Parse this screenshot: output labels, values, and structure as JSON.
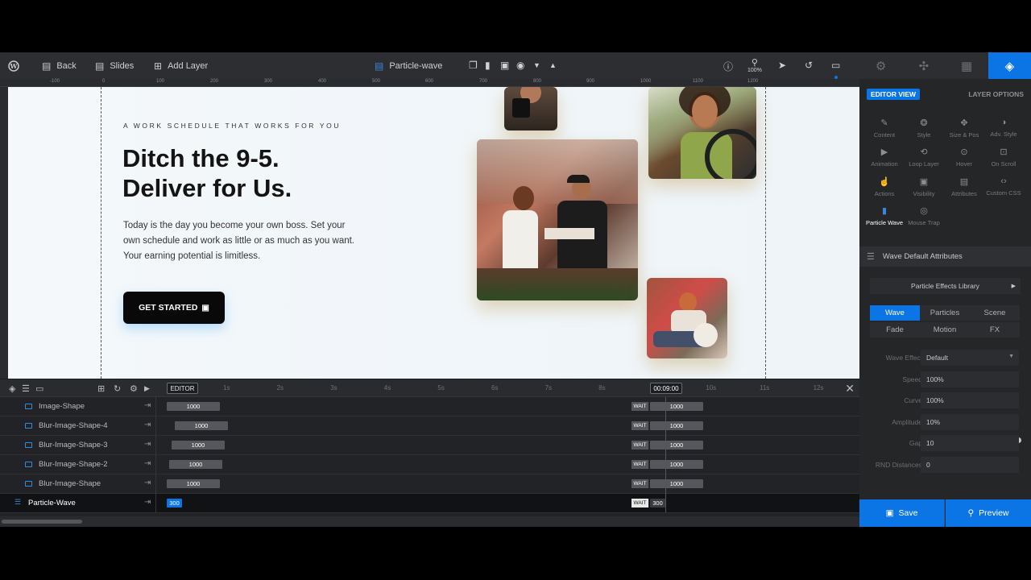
{
  "toolbar": {
    "back_label": "Back",
    "slides_label": "Slides",
    "add_layer_label": "Add Layer",
    "slide_name": "Particle-wave",
    "zoom": "100%"
  },
  "ruler": {
    "ticks": [
      "-100",
      "0",
      "100",
      "200",
      "300",
      "400",
      "500",
      "600",
      "700",
      "800",
      "900",
      "1000",
      "1100",
      "1200"
    ]
  },
  "canvas": {
    "eyebrow": "A WORK SCHEDULE THAT WORKS FOR YOU",
    "headline_line1": "Ditch the 9-5.",
    "headline_line2": "Deliver for Us.",
    "body": "Today is the day you become your own boss. Set your own schedule and work as little or as much as you want. Your earning potential is limitless.",
    "cta_label": "GET STARTED"
  },
  "panel": {
    "editor_view": "EDITOR VIEW",
    "layer_options": "LAYER OPTIONS",
    "options": [
      {
        "label": "Content",
        "icon": "pencil-icon"
      },
      {
        "label": "Style",
        "icon": "palette-icon"
      },
      {
        "label": "Size & Pos",
        "icon": "move-icon"
      },
      {
        "label": "Adv. Style",
        "icon": "contrast-icon"
      },
      {
        "label": "Animation",
        "icon": "play-icon"
      },
      {
        "label": "Loop Layer",
        "icon": "loop-icon"
      },
      {
        "label": "Hover",
        "icon": "mouse-icon"
      },
      {
        "label": "On Scroll",
        "icon": "scroll-icon"
      },
      {
        "label": "Actions",
        "icon": "hand-icon"
      },
      {
        "label": "Visibility",
        "icon": "visibility-icon"
      },
      {
        "label": "Attributes",
        "icon": "file-icon"
      },
      {
        "label": "Custom CSS",
        "icon": "code-icon"
      },
      {
        "label": "Particle Wave",
        "icon": "chart-icon"
      },
      {
        "label": "Mouse Trap",
        "icon": "target-icon"
      }
    ],
    "section_title": "Wave Default Attributes",
    "library_label": "Particle Effects Library",
    "tabs": [
      "Wave",
      "Particles",
      "Scene",
      "Fade",
      "Motion",
      "FX"
    ],
    "fields": [
      {
        "label": "Wave Effect",
        "value": "Default"
      },
      {
        "label": "Speed",
        "value": "100%"
      },
      {
        "label": "Curve",
        "value": "100%"
      },
      {
        "label": "Amplitude",
        "value": "10%"
      },
      {
        "label": "Gap",
        "value": "10"
      },
      {
        "label": "RND Distances",
        "value": "0"
      }
    ],
    "speed_fill": 1.0,
    "save_label": "Save",
    "preview_label": "Preview"
  },
  "timeline": {
    "editor_label": "EDITOR",
    "current_time": "00:09:00",
    "ticks": [
      "1s",
      "2s",
      "3s",
      "4s",
      "5s",
      "6s",
      "7s",
      "8s",
      "9s",
      "10s",
      "11s",
      "12s"
    ],
    "rows": [
      {
        "name": "Image-Shape",
        "start": "1000",
        "wait": "WAIT",
        "end": "1000"
      },
      {
        "name": "Blur-Image-Shape-4",
        "start": "1000",
        "wait": "WAIT",
        "end": "1000"
      },
      {
        "name": "Blur-Image-Shape-3",
        "start": "1000",
        "wait": "WAIT",
        "end": "1000"
      },
      {
        "name": "Blur-Image-Shape-2",
        "start": "1000",
        "wait": "WAIT",
        "end": "1000"
      },
      {
        "name": "Blur-Image-Shape",
        "start": "1000",
        "wait": "WAIT",
        "end": "1000"
      },
      {
        "name": "Particle-Wave",
        "start": "300",
        "wait": "WAIT",
        "end": "300"
      }
    ]
  },
  "colors": {
    "accent": "#0c75e6",
    "panel": "#252628",
    "toolbar": "#2d2e31"
  }
}
